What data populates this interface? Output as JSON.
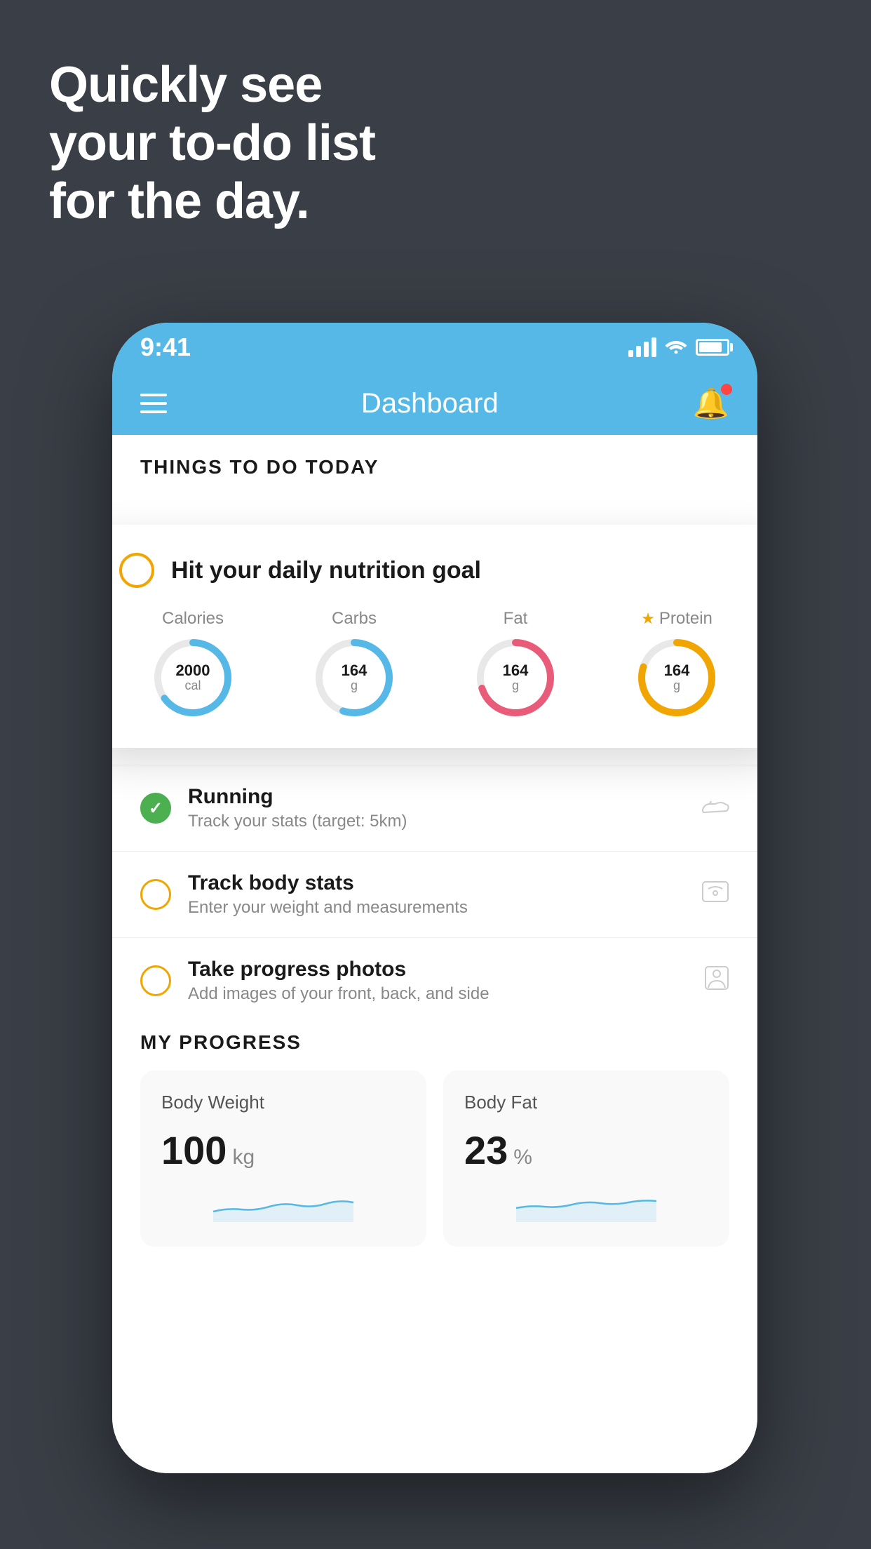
{
  "background": {
    "color": "#3a3f47"
  },
  "hero": {
    "line1": "Quickly see",
    "line2": "your to-do list",
    "line3": "for the day."
  },
  "phone": {
    "status_bar": {
      "time": "9:41"
    },
    "nav": {
      "title": "Dashboard"
    },
    "things_header": "THINGS TO DO TODAY",
    "floating_card": {
      "title": "Hit your daily nutrition goal",
      "stats": [
        {
          "label": "Calories",
          "value": "2000",
          "unit": "cal",
          "color": "#56b8e6",
          "progress": 0.65
        },
        {
          "label": "Carbs",
          "value": "164",
          "unit": "g",
          "color": "#56b8e6",
          "progress": 0.55
        },
        {
          "label": "Fat",
          "value": "164",
          "unit": "g",
          "color": "#e85c7a",
          "progress": 0.7
        },
        {
          "label": "Protein",
          "value": "164",
          "unit": "g",
          "color": "#f0a500",
          "progress": 0.8,
          "starred": true
        }
      ]
    },
    "todo_items": [
      {
        "title": "Running",
        "subtitle": "Track your stats (target: 5km)",
        "status": "green",
        "icon": "shoe"
      },
      {
        "title": "Track body stats",
        "subtitle": "Enter your weight and measurements",
        "status": "yellow",
        "icon": "scale"
      },
      {
        "title": "Take progress photos",
        "subtitle": "Add images of your front, back, and side",
        "status": "yellow",
        "icon": "person"
      }
    ],
    "progress": {
      "title": "MY PROGRESS",
      "cards": [
        {
          "title": "Body Weight",
          "value": "100",
          "unit": "kg"
        },
        {
          "title": "Body Fat",
          "value": "23",
          "unit": "%"
        }
      ]
    }
  }
}
